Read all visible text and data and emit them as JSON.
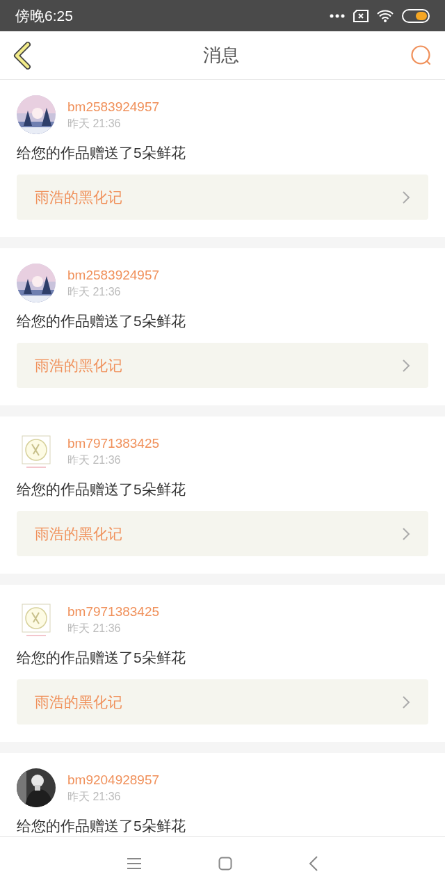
{
  "status_bar": {
    "time": "傍晚6:25"
  },
  "header": {
    "title": "消息"
  },
  "messages": [
    {
      "user": "bm2583924957",
      "time": "昨天 21:36",
      "text": "给您的作品赠送了5朵鲜花",
      "work": "雨浩的黑化记"
    },
    {
      "user": "bm2583924957",
      "time": "昨天 21:36",
      "text": "给您的作品赠送了5朵鲜花",
      "work": "雨浩的黑化记"
    },
    {
      "user": "bm7971383425",
      "time": "昨天 21:36",
      "text": "给您的作品赠送了5朵鲜花",
      "work": "雨浩的黑化记"
    },
    {
      "user": "bm7971383425",
      "time": "昨天 21:36",
      "text": "给您的作品赠送了5朵鲜花",
      "work": "雨浩的黑化记"
    },
    {
      "user": "bm9204928957",
      "time": "昨天 21:36",
      "text": "给您的作品赠送了5朵鲜花"
    }
  ]
}
